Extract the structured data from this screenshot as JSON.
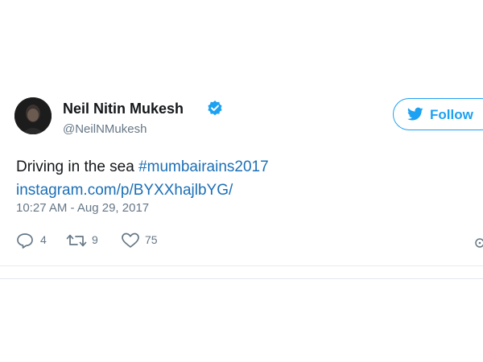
{
  "tweet": {
    "author": {
      "name": "Neil Nitin Mukesh",
      "handle": "@NeilNMukesh",
      "verified": true
    },
    "follow_label": "Follow",
    "text_prefix": "Driving in the sea ",
    "hashtag": "#mumbairains2017",
    "link": "instagram.com/p/BYXXhajlbYG/",
    "timestamp": "10:27 AM - Aug 29, 2017",
    "stats": {
      "replies": "4",
      "retweets": "9",
      "likes": "75"
    }
  },
  "colors": {
    "accent": "#1da1f2",
    "link": "#1b6fb6",
    "muted": "#657786",
    "text": "#14171a"
  },
  "icons": [
    "verified-badge-icon",
    "twitter-bird-icon",
    "reply-icon",
    "retweet-icon",
    "heart-icon",
    "more-icon"
  ]
}
